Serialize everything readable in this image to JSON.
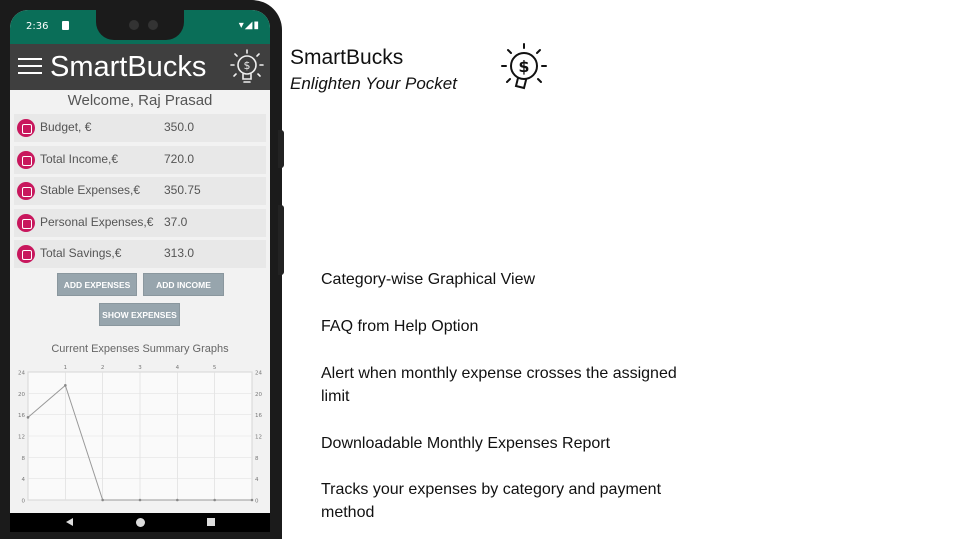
{
  "status_bar": {
    "time": "2:36",
    "system_icons": "▾◢▮"
  },
  "app": {
    "title": "SmartBucks",
    "welcome": "Welcome, Raj Prasad",
    "menu_icon": "hamburger-menu-icon",
    "logo_icon": "lightbulb-dollar-icon",
    "accent_color": "#c8175d",
    "appbar_color": "#3f3f3f",
    "statusbar_color": "#0a6e58"
  },
  "summary": [
    {
      "label": "Budget, €",
      "value": "350.0",
      "icon": "budget-icon"
    },
    {
      "label": "Total Income,€",
      "value": "720.0",
      "icon": "income-icon"
    },
    {
      "label": "Stable Expenses,€",
      "value": "350.75",
      "icon": "stable-expenses-icon"
    },
    {
      "label": "Personal Expenses,€",
      "value": "37.0",
      "icon": "personal-expenses-icon"
    },
    {
      "label": "Total Savings,€",
      "value": "313.0",
      "icon": "savings-icon"
    }
  ],
  "buttons": {
    "add_expenses": "ADD EXPENSES",
    "add_income": "ADD INCOME",
    "show_expenses": "SHOW EXPENSES"
  },
  "chart_data": {
    "type": "line",
    "title": "Current Expenses Summary Graphs",
    "x": [
      0,
      1,
      2,
      3,
      4,
      5,
      6
    ],
    "x_ticks": [
      "1",
      "2",
      "3",
      "4",
      "5"
    ],
    "y_ticks": [
      "0",
      "4",
      "8",
      "12",
      "16",
      "20",
      "24"
    ],
    "ylim": [
      0,
      24
    ],
    "series": [
      {
        "values": [
          15.5,
          21.5,
          0,
          0,
          0,
          0,
          0
        ]
      }
    ],
    "grid": true
  },
  "slide": {
    "brand_title": "SmartBucks",
    "brand_tagline": "Enlighten Your Pocket",
    "brand_logo_icon": "lightbulb-dollar-icon",
    "features": [
      "Category-wise Graphical View",
      "FAQ from Help Option",
      "Alert when monthly expense crosses the assigned limit",
      "Downloadable Monthly Expenses Report",
      "Tracks your expenses by category and payment method"
    ]
  }
}
